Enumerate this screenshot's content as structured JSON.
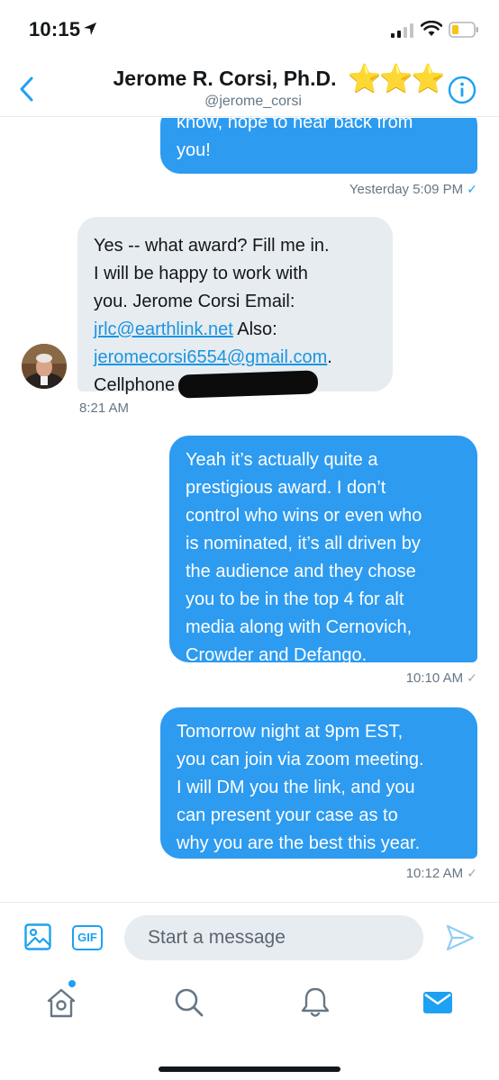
{
  "status_bar": {
    "time": "10:15"
  },
  "header": {
    "name": "Jerome R. Corsi, Ph.D.",
    "stars": "⭐⭐⭐",
    "handle": "@jerome_corsi"
  },
  "messages": [
    {
      "direction": "outgoing",
      "lines": [
        "know, hope to hear back from",
        "you!"
      ],
      "time": "Yesterday 5:09 PM",
      "status": "✓"
    },
    {
      "direction": "incoming",
      "lines": [
        "Yes -- what award?  Fill me in.",
        "I will be happy to work with",
        "you.  Jerome Corsi Email:"
      ],
      "link1": "jrlc@earthlink.net",
      "also": "Also:",
      "link2": "jeromecorsi6554@gmail.com",
      "after_link2": ".",
      "cellphone_label": "Cellphone",
      "time": "8:21 AM"
    },
    {
      "direction": "outgoing",
      "lines": [
        "Yeah it’s actually quite a",
        "prestigious award. I don’t",
        "control who wins or even who",
        "is nominated, it’s all driven by",
        "the audience and they chose",
        "you to be in the top 4 for alt",
        "media along with Cernovich,",
        "Crowder and Defango."
      ],
      "time": "10:10 AM",
      "status": "✓"
    },
    {
      "direction": "outgoing",
      "lines": [
        "Tomorrow night at 9pm EST,",
        "you can join via zoom meeting.",
        "I will DM you the link, and you",
        "can present your case as to",
        "why you are the best this year."
      ],
      "time": "10:12 AM",
      "status": "✓"
    }
  ],
  "composer": {
    "gif_label": "GIF",
    "placeholder": "Start a message"
  },
  "colors": {
    "accent": "#1da1f2",
    "outgoing_bubble": "#2d9bf0",
    "incoming_bubble": "#e6ecf0",
    "secondary_text": "#657786"
  },
  "icons": {
    "status": [
      "location-arrow-icon",
      "signal-icon",
      "wifi-icon",
      "battery-icon"
    ],
    "header": [
      "back-chevron-icon",
      "info-icon"
    ],
    "composer": [
      "image-icon",
      "gif-icon",
      "send-icon"
    ],
    "tabs": [
      "home-icon",
      "search-icon",
      "notifications-bell-icon",
      "messages-envelope-icon"
    ]
  }
}
